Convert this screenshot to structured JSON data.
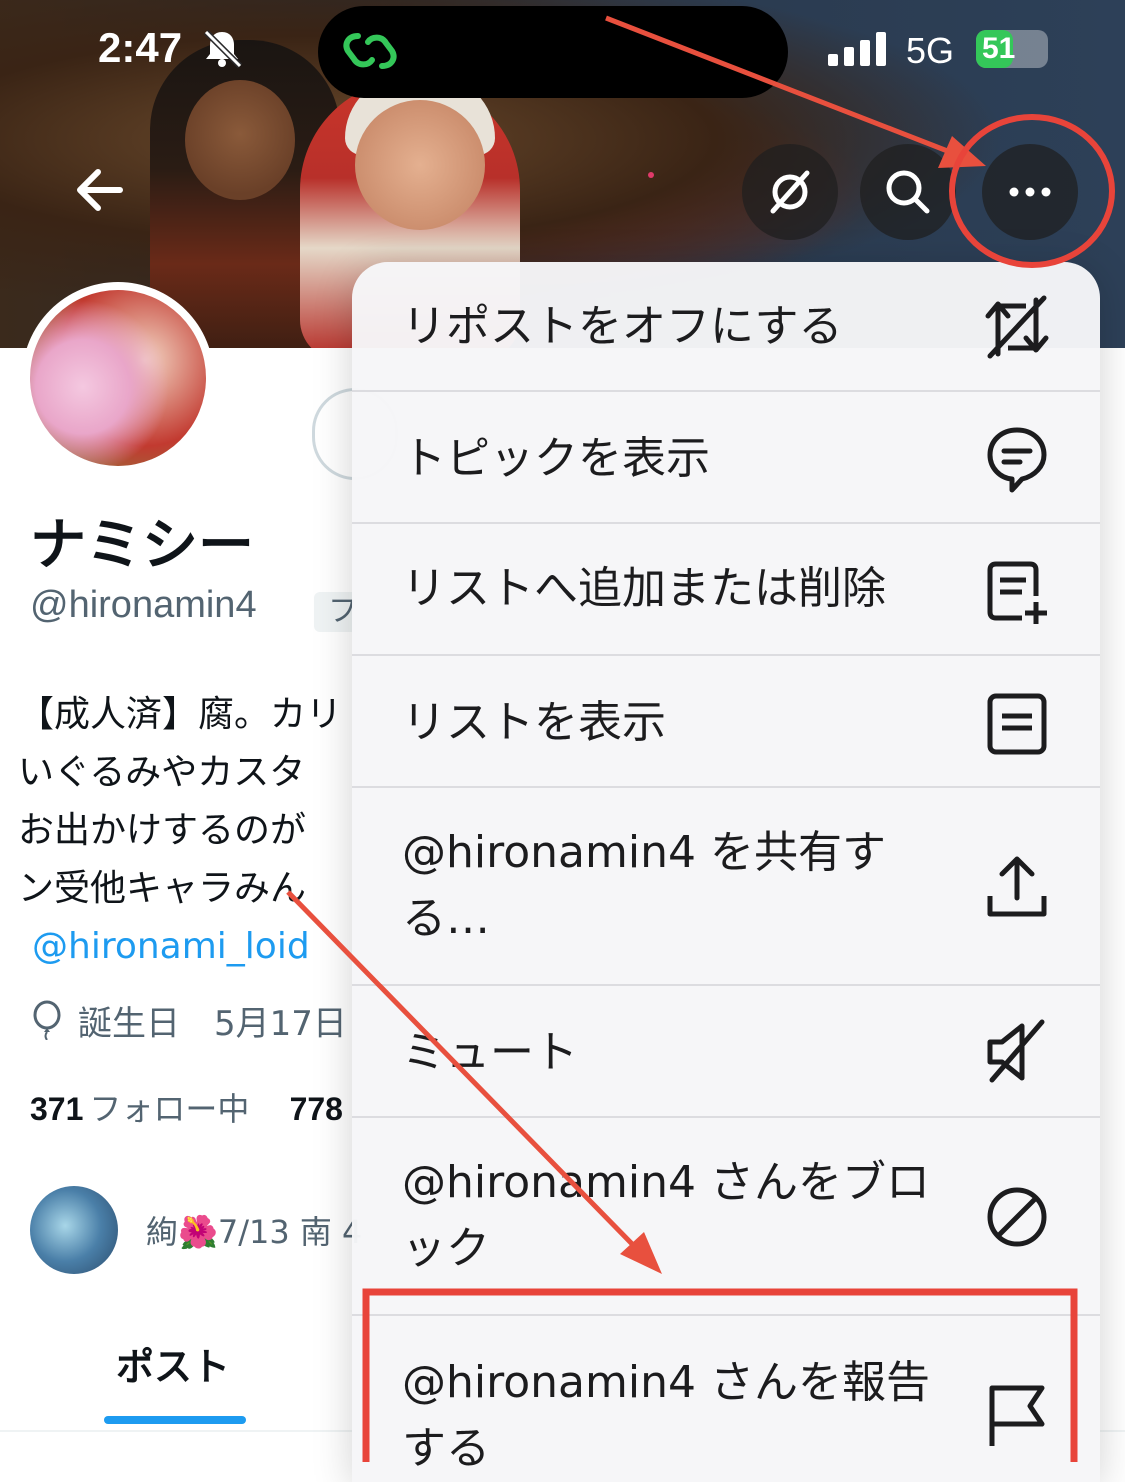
{
  "status_bar": {
    "time": "2:47",
    "network": "5G",
    "battery": "51",
    "battery_level": 0.51
  },
  "header": {
    "back_icon": "arrow-left-icon",
    "buttons": [
      {
        "name": "repost-off-icon"
      },
      {
        "name": "search-icon"
      },
      {
        "name": "more-icon"
      }
    ]
  },
  "profile": {
    "display_name": "ナミシー",
    "handle": "@hironamin4",
    "follows_badge": "フ",
    "bio_lines": [
      "【成人済】腐。カリ",
      "いぐるみやカスタ",
      "お出かけするのが",
      "ン受他キャラみん"
    ],
    "bio_link": "@hironami_loid",
    "birthday_label": "誕生日",
    "birthday_value": "5月17日",
    "following_count": "371",
    "following_label": "フォロー中",
    "followers_count": "778",
    "followed_by": "絢🌺7/13 南 4"
  },
  "tabs": {
    "active": "ポスト"
  },
  "menu": {
    "items": [
      {
        "label": "リポストをオフにする",
        "icon": "repost-off-icon"
      },
      {
        "label": "トピックを表示",
        "icon": "topic-bubble-icon"
      },
      {
        "label": "リストへ追加または削除",
        "icon": "list-add-icon"
      },
      {
        "label": "リストを表示",
        "icon": "list-icon"
      },
      {
        "label": "@hironamin4 を共有する…",
        "icon": "share-upload-icon"
      },
      {
        "label": "ミュート",
        "icon": "mute-speaker-icon"
      },
      {
        "label": "@hironamin4 さんをブロック",
        "icon": "block-icon"
      },
      {
        "label": "@hironamin4 さんを報告する",
        "icon": "flag-icon"
      }
    ]
  },
  "annotation_colors": {
    "arrow": "#e8503e",
    "highlight": "#e8443a"
  }
}
